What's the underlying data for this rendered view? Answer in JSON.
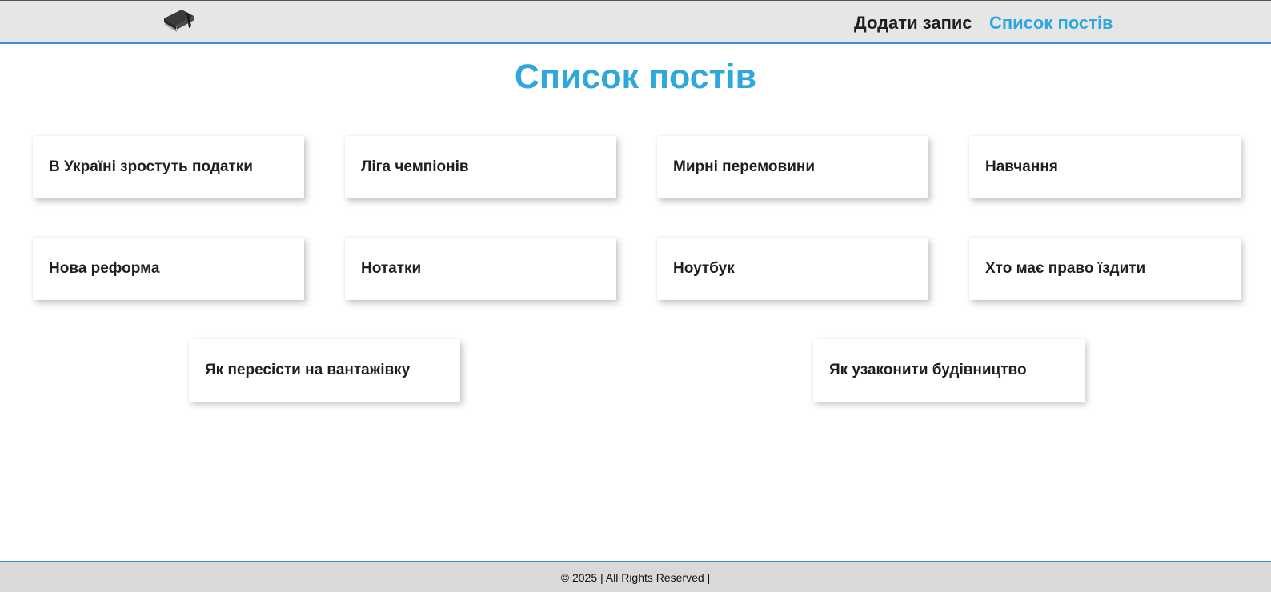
{
  "header": {
    "logo_icon": "notebook-icon",
    "nav": {
      "add_label": "Додати запис",
      "list_label": "Список постів"
    }
  },
  "main": {
    "title": "Список постів",
    "posts": [
      "В Україні зростуть податки",
      "Ліга чемпіонів",
      "Мирні перемовини",
      "Навчання",
      "Нова реформа",
      "Нотатки",
      "Ноутбук",
      "Хто має право їздити",
      "Як пересісти на вантажівку",
      "Як узаконити будівництво"
    ]
  },
  "footer": {
    "text": "© 2025 | All Rights Reserved |"
  },
  "colors": {
    "accent": "#2ea8dc",
    "header_bg": "#e6e6e6",
    "footer_bg": "#d9d9d9",
    "border": "#3a8fd6"
  }
}
